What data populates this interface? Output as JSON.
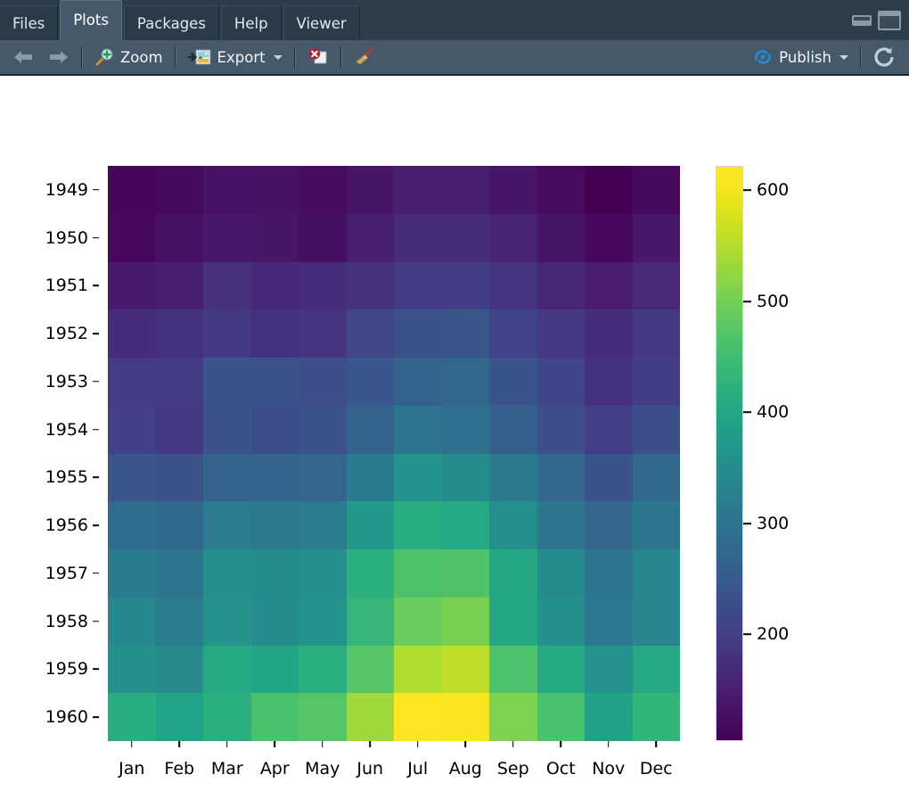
{
  "window": {
    "tabs": [
      {
        "label": "Files",
        "active": false
      },
      {
        "label": "Plots",
        "active": true
      },
      {
        "label": "Packages",
        "active": false
      },
      {
        "label": "Help",
        "active": false
      },
      {
        "label": "Viewer",
        "active": false
      }
    ],
    "minimize_icon": "minimize-pane-icon",
    "maximize_icon": "maximize-pane-icon"
  },
  "toolbar": {
    "back_icon": "back-arrow-icon",
    "forward_icon": "forward-arrow-icon",
    "zoom_label": "Zoom",
    "zoom_icon": "magnifier-plus-icon",
    "export_label": "Export",
    "export_icon": "export-image-icon",
    "export_caret": "chevron-down-icon",
    "remove_plot_icon": "remove-plot-icon",
    "clear_all_icon": "broom-icon",
    "publish_label": "Publish",
    "publish_icon": "publish-icon",
    "publish_caret": "chevron-down-icon",
    "refresh_icon": "refresh-icon"
  },
  "colors": {
    "tabbar_bg": "#2d3c4b",
    "tab_inactive_bg": "#2b3a49",
    "tab_active_bg": "#46596a",
    "toolbar_bg": "#46596a",
    "accent_blue": "#1e8fd5",
    "plot_bg": "#ffffff",
    "text_dark": "#000000"
  },
  "chart_data": {
    "type": "heatmap",
    "title": "",
    "xlabel": "",
    "ylabel": "",
    "colormap": "viridis",
    "grid": false,
    "legend_position": "right",
    "x_categories": [
      "Jan",
      "Feb",
      "Mar",
      "Apr",
      "May",
      "Jun",
      "Jul",
      "Aug",
      "Sep",
      "Oct",
      "Nov",
      "Dec"
    ],
    "y_categories": [
      "1949",
      "1950",
      "1951",
      "1952",
      "1953",
      "1954",
      "1955",
      "1956",
      "1957",
      "1958",
      "1959",
      "1960"
    ],
    "colorbar": {
      "ticks": [
        200,
        300,
        400,
        500,
        600
      ],
      "vmin": 104,
      "vmax": 622
    },
    "values": [
      [
        112,
        118,
        132,
        129,
        121,
        135,
        148,
        148,
        136,
        119,
        104,
        118
      ],
      [
        115,
        126,
        141,
        135,
        125,
        149,
        170,
        170,
        158,
        133,
        114,
        140
      ],
      [
        145,
        150,
        178,
        163,
        172,
        178,
        199,
        199,
        184,
        162,
        146,
        166
      ],
      [
        171,
        180,
        193,
        181,
        183,
        218,
        230,
        242,
        209,
        191,
        172,
        194
      ],
      [
        196,
        196,
        236,
        235,
        229,
        243,
        264,
        272,
        237,
        211,
        180,
        201
      ],
      [
        204,
        188,
        235,
        227,
        234,
        264,
        302,
        293,
        259,
        229,
        203,
        229
      ],
      [
        242,
        233,
        267,
        269,
        270,
        315,
        364,
        347,
        312,
        274,
        237,
        278
      ],
      [
        284,
        277,
        317,
        313,
        318,
        374,
        413,
        405,
        355,
        306,
        271,
        306
      ],
      [
        315,
        301,
        356,
        348,
        355,
        422,
        465,
        467,
        404,
        347,
        305,
        336
      ],
      [
        340,
        318,
        362,
        348,
        363,
        435,
        491,
        505,
        404,
        359,
        310,
        337
      ],
      [
        360,
        342,
        406,
        396,
        420,
        472,
        548,
        559,
        463,
        407,
        362,
        405
      ],
      [
        417,
        391,
        419,
        461,
        472,
        535,
        622,
        606,
        508,
        461,
        390,
        432
      ]
    ]
  }
}
